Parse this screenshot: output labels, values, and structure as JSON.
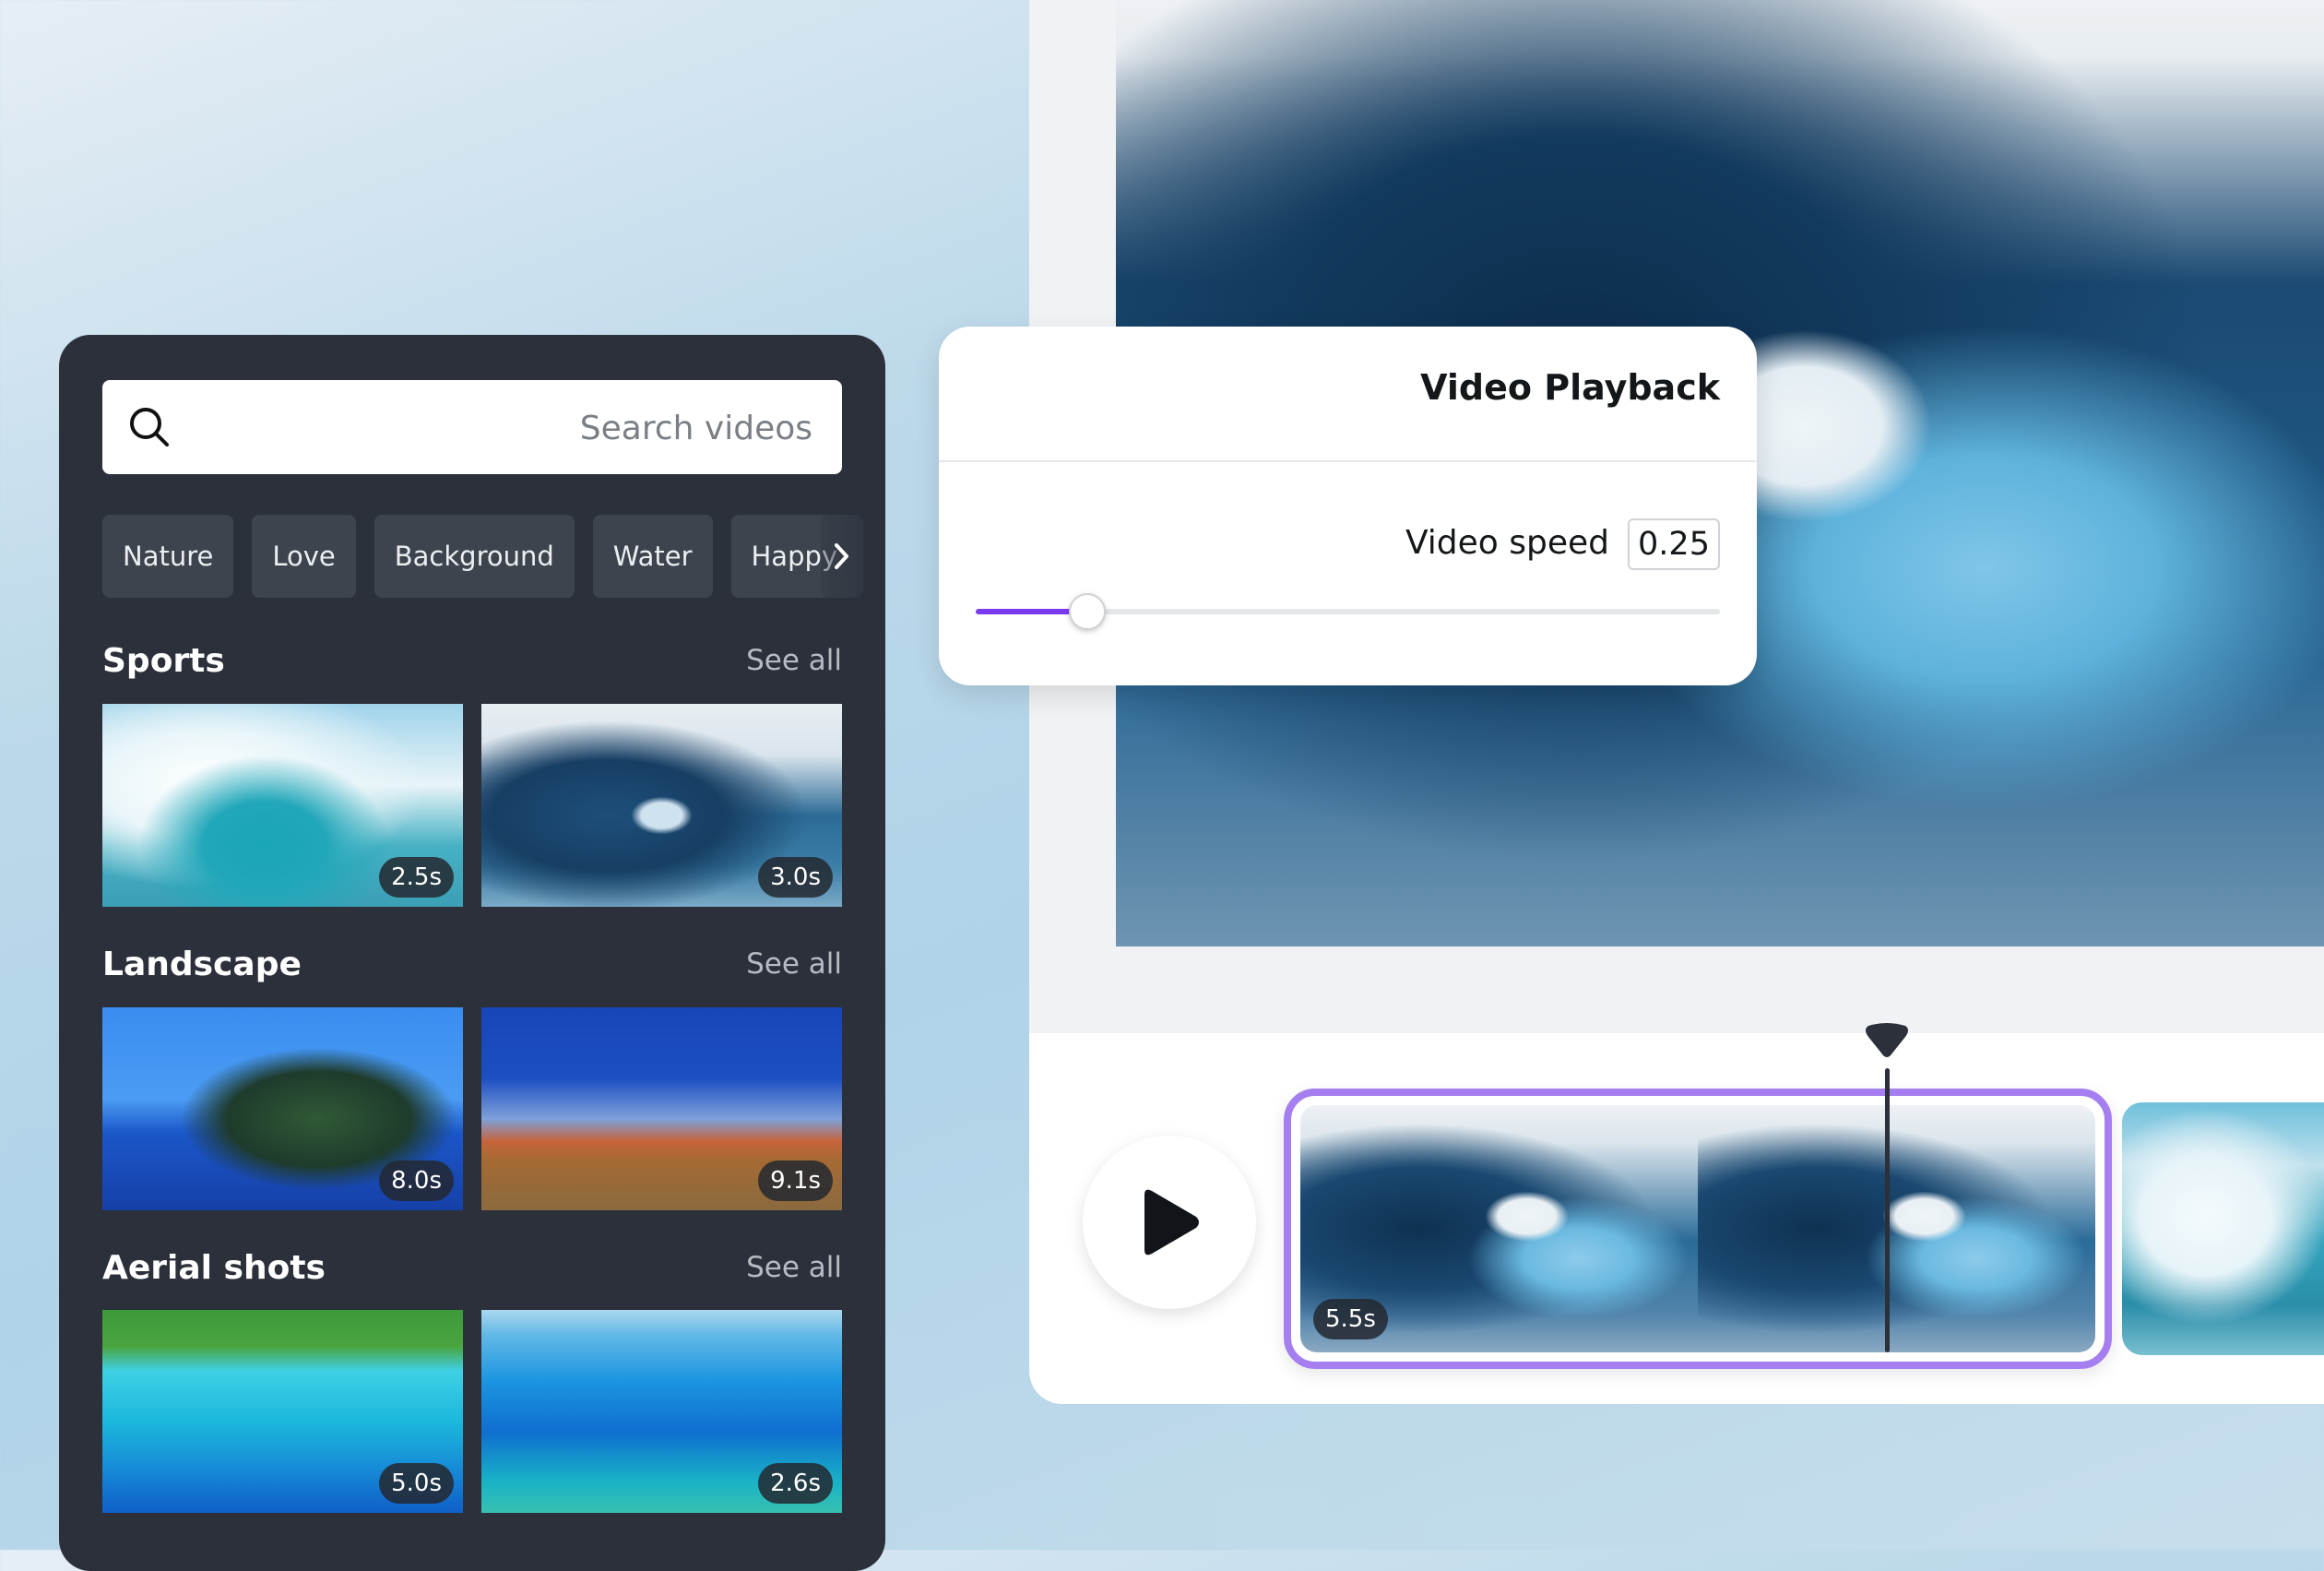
{
  "library": {
    "search": {
      "placeholder": "Search videos",
      "value": "",
      "icon": "search-icon"
    },
    "chips": [
      "Nature",
      "Love",
      "Background",
      "Water",
      "Happy"
    ],
    "chips_next_icon": "chevron-right-icon",
    "sections": [
      {
        "title": "Sports",
        "see_all": "See all",
        "items": [
          {
            "duration": "2.5s",
            "image": "surfer in wave barrel"
          },
          {
            "duration": "3.0s",
            "image": "curling ocean wave"
          }
        ]
      },
      {
        "title": "Landscape",
        "see_all": "See all",
        "items": [
          {
            "duration": "8.0s",
            "image": "tropical island with palm trees"
          },
          {
            "duration": "9.1s",
            "image": "desert road under blue sky"
          }
        ]
      },
      {
        "title": "Aerial shots",
        "see_all": "See all",
        "items": [
          {
            "duration": "5.0s",
            "image": "aerial view of island and lagoon"
          },
          {
            "duration": "2.6s",
            "image": "aerial view of open sea"
          }
        ]
      }
    ]
  },
  "editor": {
    "preview_image": "curling ocean wave",
    "playback_popup": {
      "title": "Video Playback",
      "speed_label": "Video speed",
      "speed_value": "0.25",
      "slider_fraction": 0.15
    },
    "timeline": {
      "play_icon": "play-icon",
      "selected_clip": {
        "duration": "5.5s",
        "image": "curling ocean wave"
      },
      "next_clip": {
        "image": "surfer in wave barrel"
      },
      "playhead_fraction": 0.72,
      "accent_color": "#a57ff0"
    }
  },
  "colors": {
    "slider_fill": "#7c3aed",
    "panel_bg": "#2b303a"
  }
}
